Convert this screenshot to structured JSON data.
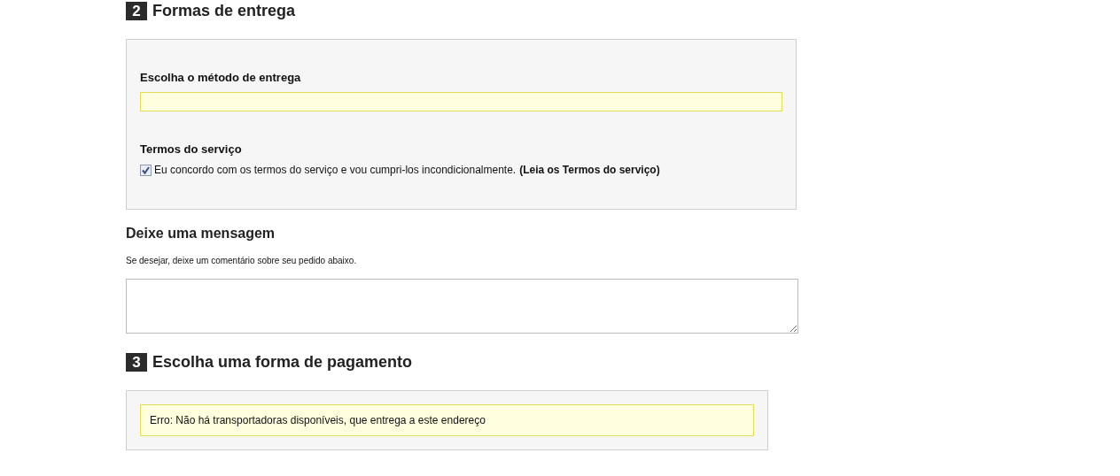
{
  "shipping": {
    "number": "2",
    "title": "Formas de entrega",
    "method_label": "Escolha o método de entrega",
    "terms_label": "Termos do serviço",
    "terms": {
      "checked": true,
      "text": "Eu concordo com os termos do serviço e vou cumpri-los incondicionalmente.",
      "link": "(Leia os Termos do serviço)"
    }
  },
  "message": {
    "title": "Deixe uma mensagem",
    "hint": "Se desejar, deixe um comentário sobre seu pedido abaixo."
  },
  "payment": {
    "number": "3",
    "title": "Escolha uma forma de pagamento",
    "error": "Erro: Não há transportadoras disponíveis, que entrega a este endereço"
  }
}
